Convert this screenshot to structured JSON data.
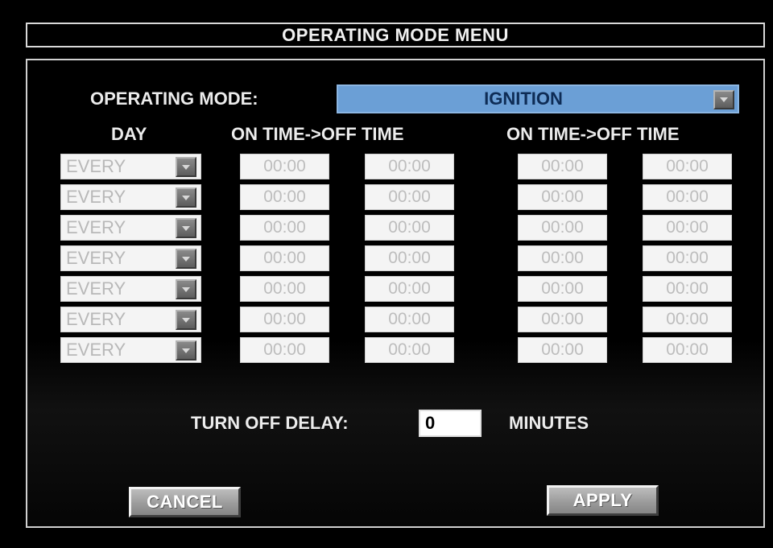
{
  "title": "OPERATING MODE MENU",
  "operating_mode": {
    "label": "OPERATING MODE:",
    "value": "IGNITION"
  },
  "columns": {
    "day": "DAY",
    "period1": "ON TIME->OFF TIME",
    "period2": "ON TIME->OFF TIME"
  },
  "schedule": [
    {
      "day": "EVERY",
      "on1": "00:00",
      "off1": "00:00",
      "on2": "00:00",
      "off2": "00:00"
    },
    {
      "day": "EVERY",
      "on1": "00:00",
      "off1": "00:00",
      "on2": "00:00",
      "off2": "00:00"
    },
    {
      "day": "EVERY",
      "on1": "00:00",
      "off1": "00:00",
      "on2": "00:00",
      "off2": "00:00"
    },
    {
      "day": "EVERY",
      "on1": "00:00",
      "off1": "00:00",
      "on2": "00:00",
      "off2": "00:00"
    },
    {
      "day": "EVERY",
      "on1": "00:00",
      "off1": "00:00",
      "on2": "00:00",
      "off2": "00:00"
    },
    {
      "day": "EVERY",
      "on1": "00:00",
      "off1": "00:00",
      "on2": "00:00",
      "off2": "00:00"
    },
    {
      "day": "EVERY",
      "on1": "00:00",
      "off1": "00:00",
      "on2": "00:00",
      "off2": "00:00"
    }
  ],
  "turn_off_delay": {
    "label": "TURN OFF DELAY:",
    "value": "0",
    "unit": "MINUTES"
  },
  "buttons": {
    "cancel": "CANCEL",
    "apply": "APPLY"
  },
  "icons": {
    "dropdown": "chevron-down-icon"
  },
  "colors": {
    "mode_select_bg": "#6b9fd6",
    "background": "#000000",
    "field_bg": "#f4f4f4"
  }
}
